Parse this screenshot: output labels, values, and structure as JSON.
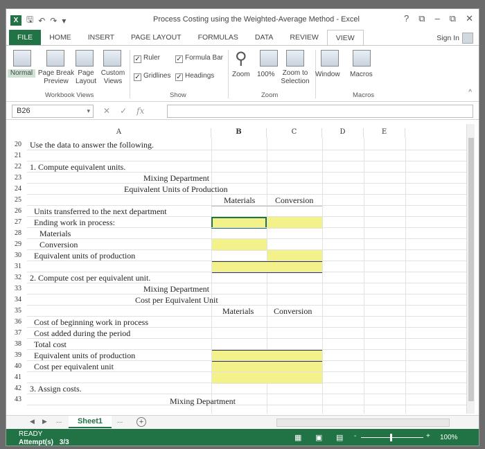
{
  "window": {
    "title": "Process Costing using the Weighted-Average Method - Excel",
    "help": "?",
    "minimize": "–",
    "restore": "⧉",
    "close": "✕"
  },
  "tabs": [
    "FILE",
    "HOME",
    "INSERT",
    "PAGE LAYOUT",
    "FORMULAS",
    "DATA",
    "REVIEW",
    "VIEW"
  ],
  "signin": "Sign In",
  "ribbon": {
    "workbook_views": [
      "Normal",
      "Page Break Preview",
      "Page Layout",
      "Custom Views"
    ],
    "workbook_views_group": "Workbook Views",
    "show": {
      "ruler": "Ruler",
      "formula_bar": "Formula Bar",
      "gridlines": "Gridlines",
      "headings": "Headings"
    },
    "show_group": "Show",
    "zoom": {
      "zoom": "Zoom",
      "hundred": "100%",
      "selection": "Zoom to Selection"
    },
    "zoom_group": "Zoom",
    "window": "Window",
    "macros": "Macros",
    "macros_group": "Macros"
  },
  "formula_bar": {
    "name_box": "B26",
    "fx": "fx",
    "value": ""
  },
  "columns": [
    "A",
    "B",
    "C",
    "D",
    "E"
  ],
  "rows": {
    "r20": "Use the data to answer the following.",
    "r22": "1. Compute equivalent units.",
    "r23": "Mixing Department",
    "r24": "Equivalent Units of Production",
    "r25_b": "Materials",
    "r25_c": "Conversion",
    "r26": "Units transferred to the next department",
    "r27": "Ending work in process:",
    "r28": "Materials",
    "r29": "Conversion",
    "r30": "Equivalent units of production",
    "r32": "2. Compute cost per equivalent unit.",
    "r33": "Mixing Department",
    "r34": "Cost per Equivalent Unit",
    "r35_b": "Materials",
    "r35_c": "Conversion",
    "r36": "Cost of beginning work in process",
    "r37": "Cost added during the period",
    "r38": "Total cost",
    "r39": "Equivalent units of production",
    "r40": "Cost per equivalent unit",
    "r42": "3. Assign costs.",
    "r43": "Mixing Department"
  },
  "row_numbers": [
    "20",
    "21",
    "22",
    "23",
    "24",
    "25",
    "26",
    "27",
    "28",
    "29",
    "30",
    "31",
    "32",
    "33",
    "34",
    "35",
    "36",
    "37",
    "38",
    "39",
    "40",
    "41",
    "42",
    "43"
  ],
  "sheet_tab": "Sheet1",
  "sheet_more": "...",
  "status": {
    "ready": "READY",
    "attempts_label": "Attempt(s)",
    "attempts_value": "3/3",
    "zoom": "100%"
  },
  "colors": {
    "accent": "#217346",
    "highlight": "#f3f18a"
  }
}
